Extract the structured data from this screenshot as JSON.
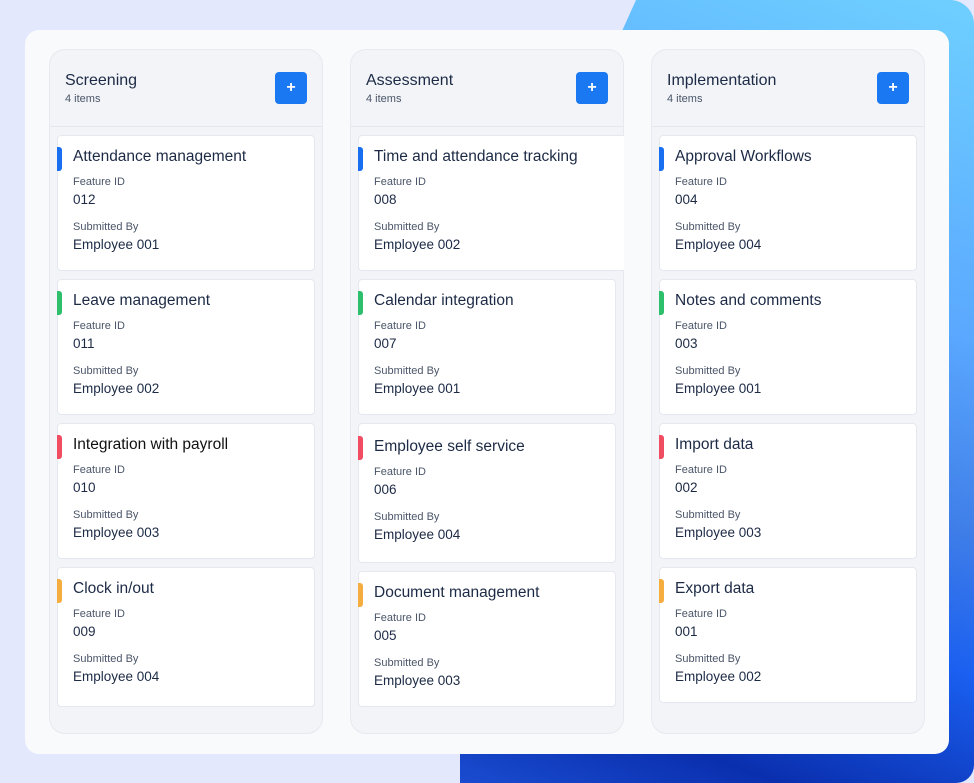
{
  "colors": {
    "accent_button": "#1a78f2",
    "priority_blue": "#1a6ff0",
    "priority_green": "#2dbf6c",
    "priority_red": "#f04d63",
    "priority_orange": "#f5ad3f"
  },
  "labels": {
    "feature_id": "Feature ID",
    "submitted_by": "Submitted By",
    "add_button": "+"
  },
  "columns": [
    {
      "title": "Screening",
      "count": "4 items",
      "cards": [
        {
          "title": "Attendance management",
          "feature_id": "012",
          "submitted_by": "Employee 001",
          "accent": "blue"
        },
        {
          "title": "Leave management",
          "feature_id": "011",
          "submitted_by": "Employee 002",
          "accent": "green"
        },
        {
          "title": "Integration with payroll",
          "feature_id": "010",
          "submitted_by": "Employee 003",
          "accent": "red"
        },
        {
          "title": "Clock in/out",
          "feature_id": "009",
          "submitted_by": "Employee 004",
          "accent": "orange"
        }
      ]
    },
    {
      "title": "Assessment",
      "count": "4 items",
      "cards": [
        {
          "title": "Time and attendance tracking",
          "feature_id": "008",
          "submitted_by": "Employee 002",
          "accent": "blue"
        },
        {
          "title": "Calendar integration",
          "feature_id": "007",
          "submitted_by": "Employee 001",
          "accent": "green"
        },
        {
          "title": "Employee self service",
          "feature_id": "006",
          "submitted_by": "Employee 004",
          "accent": "red"
        },
        {
          "title": "Document management",
          "feature_id": "005",
          "submitted_by": "Employee 003",
          "accent": "orange"
        }
      ]
    },
    {
      "title": "Implementation",
      "count": "4 items",
      "cards": [
        {
          "title": "Approval Workflows",
          "feature_id": "004",
          "submitted_by": "Employee 004",
          "accent": "blue"
        },
        {
          "title": "Notes and comments",
          "feature_id": "003",
          "submitted_by": "Employee 001",
          "accent": "green"
        },
        {
          "title": "Import data",
          "feature_id": "002",
          "submitted_by": "Employee 003",
          "accent": "red"
        },
        {
          "title": "Export data",
          "feature_id": "001",
          "submitted_by": "Employee 002",
          "accent": "orange"
        }
      ]
    }
  ]
}
